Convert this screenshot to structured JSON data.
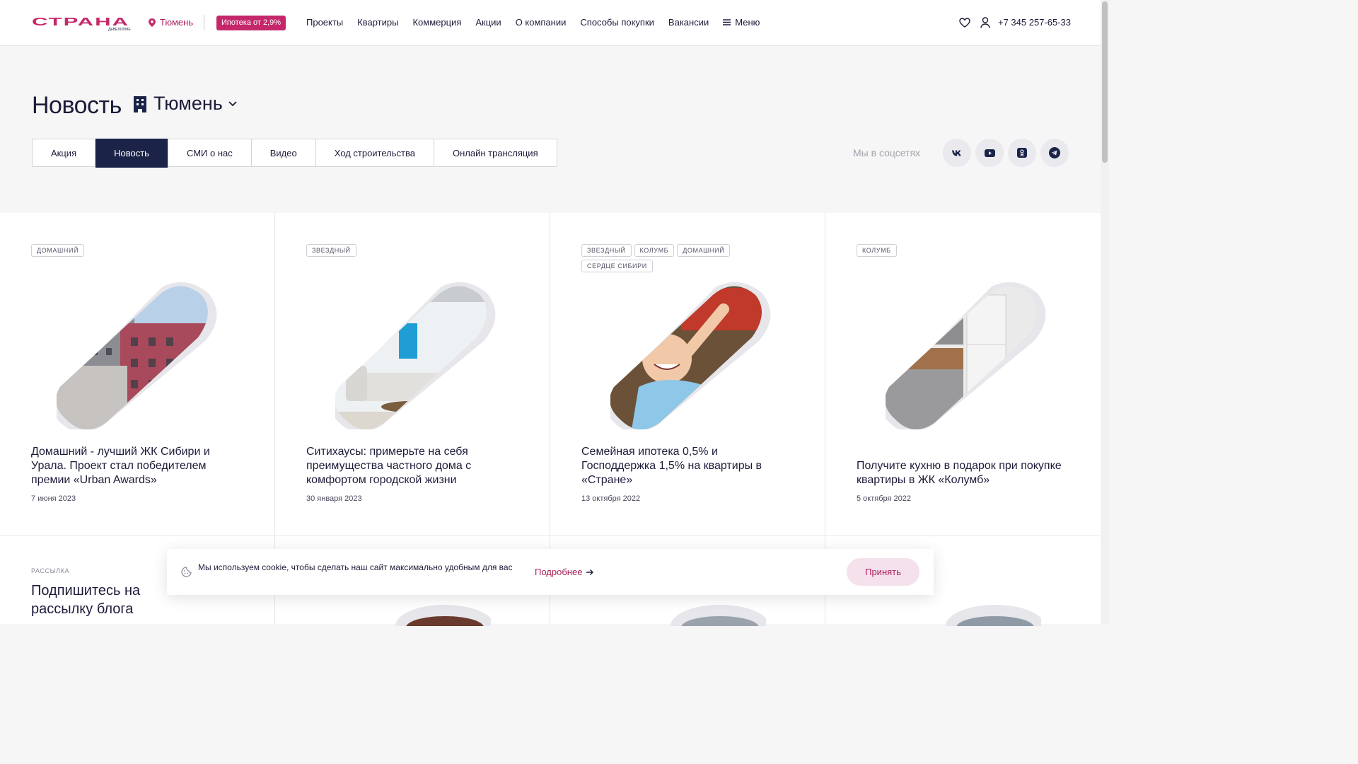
{
  "header": {
    "logo_text": "СТРАНА девелопмент",
    "city": "Тюмень",
    "mortgage_badge": "Ипотека от 2,9%",
    "nav": [
      "Проекты",
      "Квартиры",
      "Коммерция",
      "Акции",
      "О компании",
      "Способы покупки",
      "Вакансии"
    ],
    "menu_label": "Меню",
    "phone": "+7 345 257-65-33",
    "icons": [
      "map-pin-icon",
      "hamburger-icon",
      "heart-icon",
      "user-icon"
    ]
  },
  "page": {
    "title": "Новость",
    "city_select": "Тюмень",
    "tabs": [
      {
        "label": "Акция",
        "active": false
      },
      {
        "label": "Новость",
        "active": true
      },
      {
        "label": "СМИ о нас",
        "active": false
      },
      {
        "label": "Видео",
        "active": false
      },
      {
        "label": "Ход строительства",
        "active": false
      },
      {
        "label": "Онлайн трансляция",
        "active": false
      }
    ],
    "socials_label": "Мы в соцсетях",
    "socials": [
      "vk-icon",
      "youtube-icon",
      "odnoklassniki-icon",
      "telegram-icon"
    ]
  },
  "cards": [
    {
      "tags": [
        "ДОМАШНИЙ"
      ],
      "title": "Домашний - лучший ЖК Сибири и Урала. Проект стал победителем премии «Urban Awards»",
      "date": "7 июня 2023"
    },
    {
      "tags": [
        "ЗВЕЗДНЫЙ"
      ],
      "title": "Ситихаусы: примерьте на себя преимущества частного дома с комфортом городской жизни",
      "date": "30 января 2023"
    },
    {
      "tags": [
        "ЗВЕЗДНЫЙ",
        "КОЛУМБ",
        "ДОМАШНИЙ",
        "СЕРДЦЕ СИБИРИ"
      ],
      "title": "Семейная ипотека 0,5% и Господдержка 1,5% на квартиры в «Стране»",
      "date": "13 октября 2022"
    },
    {
      "tags": [
        "КОЛУМБ"
      ],
      "title": "Получите кухню в подарок при покупке квартиры в ЖК «Колумб»",
      "date": "5 октября 2022"
    }
  ],
  "subscribe": {
    "caption": "РАССЫЛКА",
    "title": "Подпишитесь на рассылку блога"
  },
  "cookie": {
    "text": "Мы используем cookie, чтобы сделать наш сайт максимально удобным для вас",
    "more": "Подробнее",
    "accept": "Принять"
  },
  "colors": {
    "brand": "#c4286a",
    "dark": "#1b2448",
    "accent_text": "#b0205d"
  }
}
